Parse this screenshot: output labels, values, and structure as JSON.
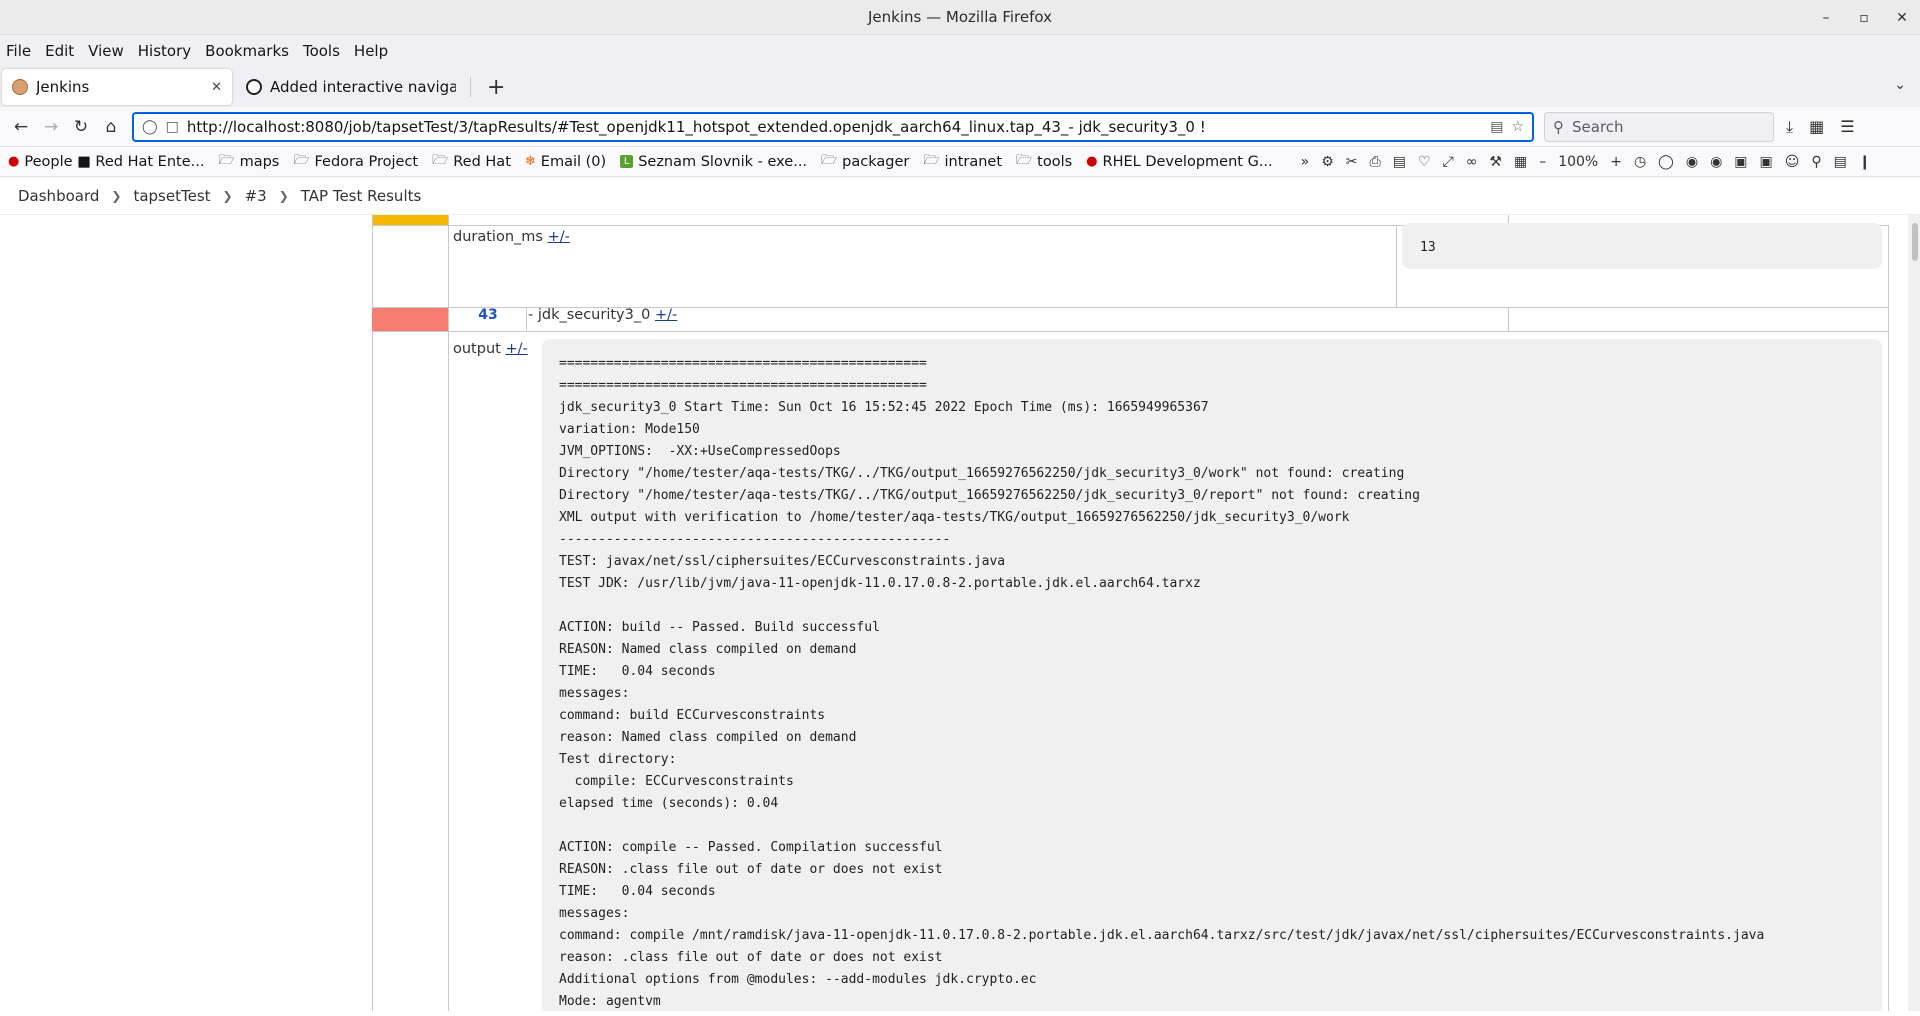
{
  "window": {
    "title": "Jenkins — Mozilla Firefox"
  },
  "menu": [
    "File",
    "Edit",
    "View",
    "History",
    "Bookmarks",
    "Tools",
    "Help"
  ],
  "tabs": [
    {
      "label": "Jenkins",
      "active": true
    },
    {
      "label": "Added interactive navigati",
      "active": false
    }
  ],
  "nav": {
    "url": "http://localhost:8080/job/tapsetTest/3/tapResults/#Test_openjdk11_hotspot_extended.openjdk_aarch64_linux.tap_43_- jdk_security3_0 !",
    "search_placeholder": "Search",
    "zoom": "100%"
  },
  "bookmarks": [
    {
      "label": "People ■ Red Hat Ente...",
      "icon": "redhat-icon"
    },
    {
      "label": "maps",
      "icon": "folder-icon"
    },
    {
      "label": "Fedora Project",
      "icon": "folder-icon"
    },
    {
      "label": "Red Hat",
      "icon": "folder-icon"
    },
    {
      "label": "Email (0)",
      "icon": "email-icon"
    },
    {
      "label": "Seznam Slovnik - exe...",
      "icon": "seznam-icon"
    },
    {
      "label": "packager",
      "icon": "folder-icon"
    },
    {
      "label": "intranet",
      "icon": "folder-icon"
    },
    {
      "label": "tools",
      "icon": "folder-icon"
    },
    {
      "label": "RHEL Development G...",
      "icon": "redhat-icon"
    }
  ],
  "breadcrumb": [
    "Dashboard",
    "tapsetTest",
    "#3",
    "TAP Test Results"
  ],
  "colors": {
    "status_fail": "#f47c70",
    "status_warn": "#f5b800",
    "link": "#1e56b5"
  },
  "page": {
    "duration_label": "duration_ms",
    "duration_value": "13",
    "toggle": "+/-",
    "test_number": "43",
    "test_name": "- jdk_security3_0",
    "output_label": "output",
    "output_lines": [
      "===============================================",
      "===============================================",
      "jdk_security3_0 Start Time: Sun Oct 16 15:52:45 2022 Epoch Time (ms): 1665949965367",
      "variation: Mode150",
      "JVM_OPTIONS:  -XX:+UseCompressedOops",
      "Directory \"/home/tester/aqa-tests/TKG/../TKG/output_16659276562250/jdk_security3_0/work\" not found: creating",
      "Directory \"/home/tester/aqa-tests/TKG/../TKG/output_16659276562250/jdk_security3_0/report\" not found: creating",
      "XML output with verification to /home/tester/aqa-tests/TKG/output_16659276562250/jdk_security3_0/work",
      "--------------------------------------------------",
      "TEST: javax/net/ssl/ciphersuites/ECCurvesconstraints.java",
      "TEST JDK: /usr/lib/jvm/java-11-openjdk-11.0.17.0.8-2.portable.jdk.el.aarch64.tarxz",
      "",
      "ACTION: build -- Passed. Build successful",
      "REASON: Named class compiled on demand",
      "TIME:   0.04 seconds",
      "messages:",
      "command: build ECCurvesconstraints",
      "reason: Named class compiled on demand",
      "Test directory:",
      "  compile: ECCurvesconstraints",
      "elapsed time (seconds): 0.04",
      "",
      "ACTION: compile -- Passed. Compilation successful",
      "REASON: .class file out of date or does not exist",
      "TIME:   0.04 seconds",
      "messages:",
      "command: compile /mnt/ramdisk/java-11-openjdk-11.0.17.0.8-2.portable.jdk.el.aarch64.tarxz/src/test/jdk/javax/net/ssl/ciphersuites/ECCurvesconstraints.java",
      "reason: .class file out of date or does not exist",
      "Additional options from @modules: --add-modules jdk.crypto.ec",
      "Mode: agentvm"
    ]
  }
}
